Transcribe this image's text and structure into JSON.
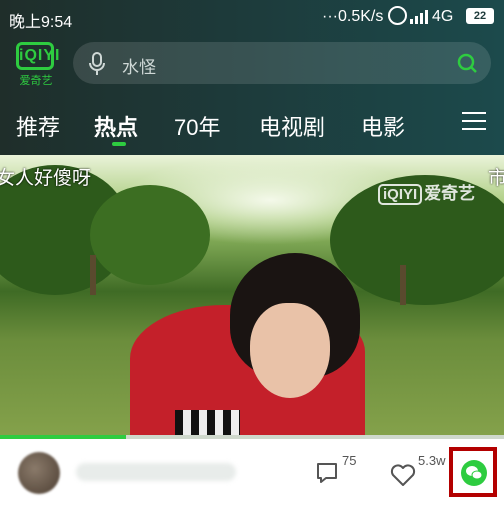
{
  "status_bar": {
    "time": "晚上9:54",
    "network_speed": "···0.5K/s",
    "network_type": "4G",
    "battery": "22"
  },
  "app": {
    "logo_text": "iQIYI",
    "logo_caption": "爱奇艺",
    "brand_color": "#2ecc40"
  },
  "search": {
    "placeholder": "水怪"
  },
  "tabs": [
    {
      "label": "推荐",
      "active": false
    },
    {
      "label": "热点",
      "active": true
    },
    {
      "label": "70年",
      "active": false
    },
    {
      "label": "电视剧",
      "active": false
    },
    {
      "label": "电影",
      "active": false
    }
  ],
  "video": {
    "overlay_text": "女人好傻呀",
    "watermark_logo": "iQIYI",
    "watermark_name": "爱奇艺",
    "right_edge_text": "市",
    "progress": 0.25
  },
  "actions": {
    "comment_count": "75",
    "like_count": "5.3w"
  }
}
